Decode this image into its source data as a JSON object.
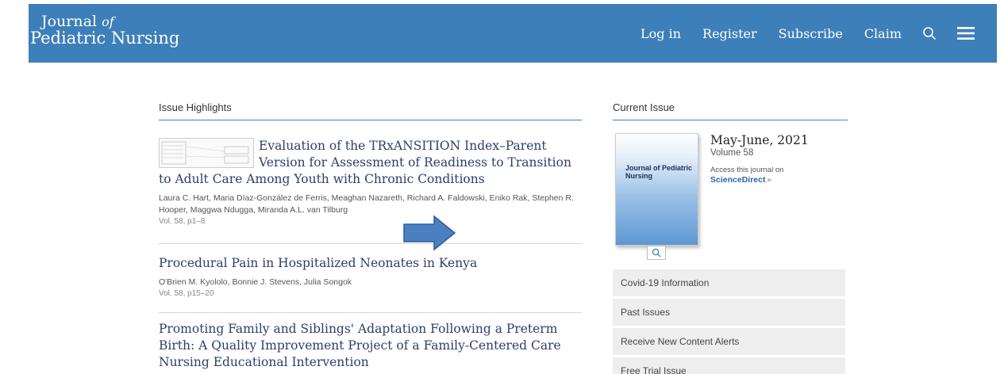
{
  "header": {
    "logo_line1": "Journal",
    "logo_line1_italic": "of",
    "logo_line2": "Pediatric Nursing",
    "nav": [
      "Log in",
      "Register",
      "Subscribe",
      "Claim"
    ],
    "search_icon": "search-icon",
    "menu_icon": "hamburger-menu-icon",
    "color": "#3d7fb8"
  },
  "highlights": {
    "title": "Issue Highlights",
    "articles": [
      {
        "title": "Evaluation of the TRxANSITION Index–Parent Version for Assessment of Readiness to Transition to Adult Care Among Youth with Chronic Conditions",
        "authors": "Laura C. Hart, Maria Díaz-González de Ferris, Meaghan Nazareth, Richard A. Faldowski, Eniko Rak, Stephen R. Hooper, Maggwa Ndugga, Miranda A.L. van Tilburg",
        "vol": "Vol. 58, p1–8"
      },
      {
        "title": "Procedural Pain in Hospitalized Neonates in Kenya",
        "authors": "O'Brien M. Kyololo, Bonnie J. Stevens, Julia Songok",
        "vol": "Vol. 58, p15–20"
      },
      {
        "title": "Promoting Family and Siblings' Adaptation Following a Preterm Birth: A Quality Improvement Project of a Family-Centered Care Nursing Educational Intervention"
      }
    ]
  },
  "current_issue": {
    "title": "Current Issue",
    "cover_journal": "Journal of Pediatric Nursing",
    "date": "May-June, 2021",
    "volume": "Volume 58",
    "access_text": "Access this journal on",
    "sd_link": "ScienceDirect",
    "menu": [
      "Covid-19 Information",
      "Past Issues",
      "Receive New Content Alerts",
      "Free Trial Issue"
    ]
  }
}
